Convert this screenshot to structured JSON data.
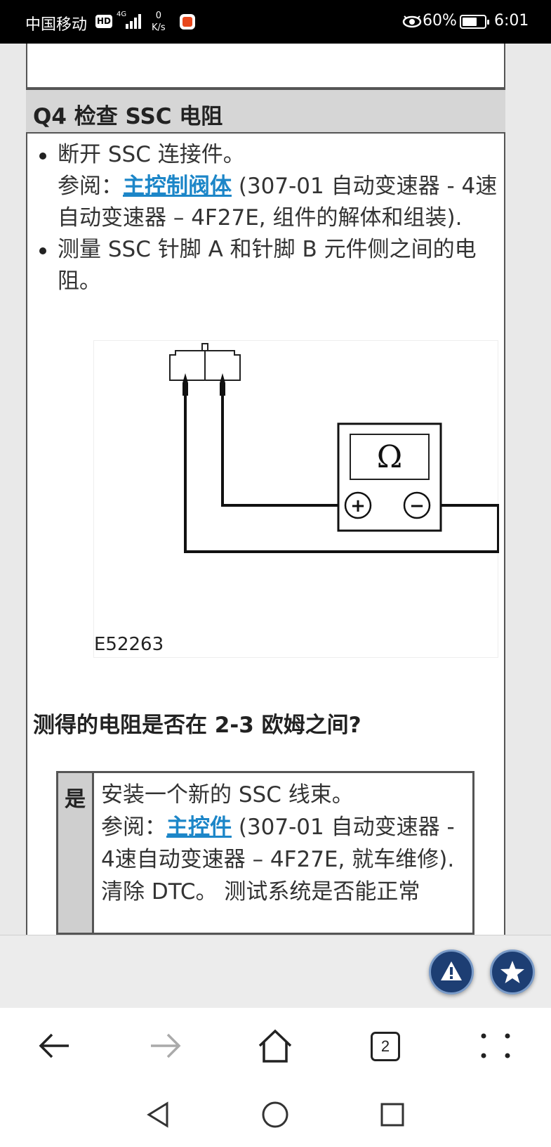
{
  "status_bar": {
    "carrier": "中国移动",
    "hd": "HD",
    "network": "4G",
    "speed_value": "0",
    "speed_unit": "K/s",
    "battery_percent": "60%",
    "time": "6:01"
  },
  "section": {
    "title": "Q4 检查 SSC 电阻"
  },
  "steps": [
    {
      "text": "断开 SSC 连接件。",
      "ref_prefix": "参阅：",
      "ref_link": "主控制阀体",
      "ref_suffix": " (307-01 自动变速器 - 4速自动变速器 – 4F27E, 组件的解体和组装)."
    },
    {
      "text": "测量 SSC 针脚 A 和针脚 B 元件侧之间的电阻。"
    }
  ],
  "figure": {
    "id": "E52263",
    "meter_symbol": "Ω",
    "plus": "+",
    "minus": "−"
  },
  "question": "测得的电阻是否在 2-3 欧姆之间?",
  "answer": {
    "key": "是",
    "line1": "安装一个新的 SSC 线束。",
    "ref_prefix": "参阅：",
    "ref_link": "主控件",
    "ref_suffix": " (307-01 自动变速器 - 4速自动变速器 – 4F27E, 就车维修).",
    "line3": "清除 DTC。 测试系统是否能正常"
  },
  "browser": {
    "tab_count": "2"
  },
  "colors": {
    "link": "#1c86c8",
    "fab": "#1d3e73"
  }
}
